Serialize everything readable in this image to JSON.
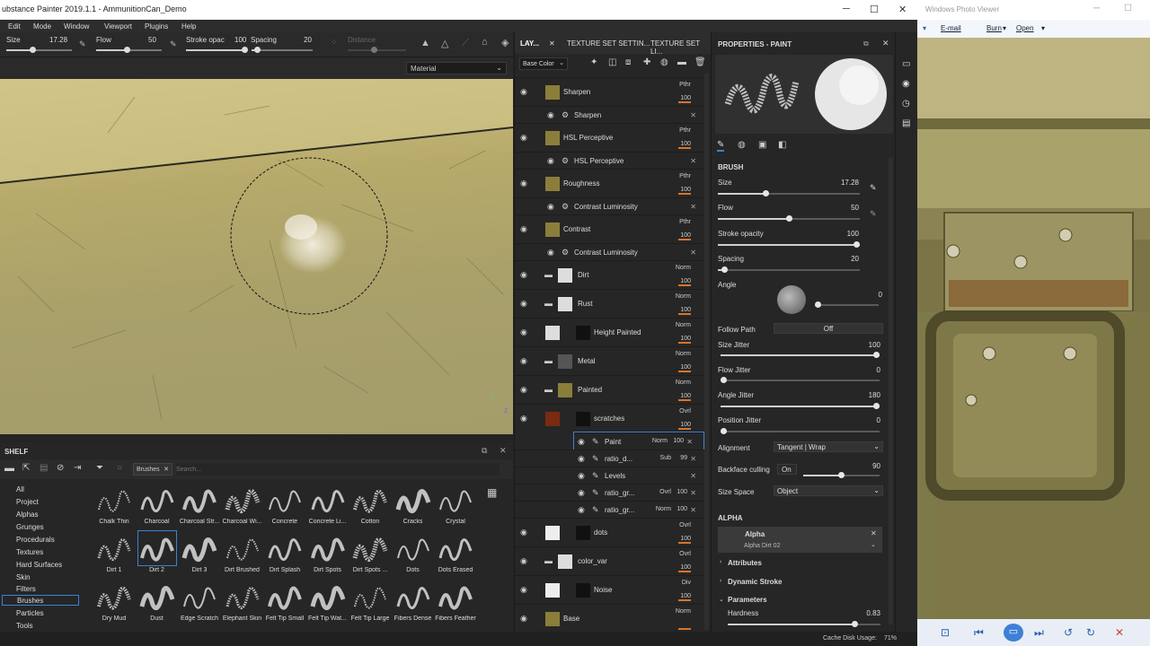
{
  "window": {
    "title": "ubstance Painter 2019.1.1 - AmmunitionCan_Demo"
  },
  "menu": [
    "Edit",
    "Mode",
    "Window",
    "Viewport",
    "Plugins",
    "Help"
  ],
  "toolbar": {
    "size_label": "Size",
    "size_value": "17.28",
    "flow_label": "Flow",
    "flow_value": "50",
    "stroke_label": "Stroke opac",
    "stroke_value": "100",
    "spacing_label": "Spacing",
    "spacing_value": "20",
    "distance_label": "Distance"
  },
  "viewport": {
    "material_select": "Material",
    "axis_x": "Z",
    "axis_y": "Y"
  },
  "shelf": {
    "title": "SHELF",
    "filter_chip": "Brushes",
    "search_placeholder": "Search...",
    "categories": [
      "All",
      "Project",
      "Alphas",
      "Grunges",
      "Procedurals",
      "Textures",
      "Hard Surfaces",
      "Skin",
      "Filters",
      "Brushes",
      "Particles",
      "Tools"
    ],
    "selected_category": "Brushes",
    "row1": [
      "Chalk Thin",
      "Charcoal",
      "Charcoal Str...",
      "Charcoal Wi...",
      "Concrete",
      "Concrete Li...",
      "Cotton",
      "Cracks",
      "Crystal"
    ],
    "row2": [
      "Dirt 1",
      "Dirt 2",
      "Dirt 3",
      "Dirt Brushed",
      "Dirt Splash",
      "Dirt Spots",
      "Dirt Spots ...",
      "Dots",
      "Dots Erased"
    ],
    "row3": [
      "Dry Mud",
      "Dust",
      "Edge Scratch",
      "Elephant Skin",
      "Felt Tip Small",
      "Felt Tip Wat...",
      "Felt Tip Large",
      "Fibers Dense",
      "Fibers Feather"
    ],
    "selected_brush": "Dirt 2"
  },
  "layers": {
    "tabs": [
      "LAY...",
      "TEXTURE SET SETTIN...",
      "TEXTURE SET LI..."
    ],
    "channel_select": "Base Color",
    "rows": [
      {
        "name": "Sharpen",
        "blend": "Pthr",
        "opacity": "100",
        "kind": "layer"
      },
      {
        "name": "Sharpen",
        "kind": "effect"
      },
      {
        "name": "HSL Perceptive",
        "blend": "Pthr",
        "opacity": "100",
        "kind": "layer"
      },
      {
        "name": "HSL Perceptive",
        "kind": "effect"
      },
      {
        "name": "Roughness",
        "blend": "Pthr",
        "opacity": "100",
        "kind": "layer"
      },
      {
        "name": "Contrast Luminosity",
        "kind": "effect"
      },
      {
        "name": "Contrast",
        "blend": "Pthr",
        "opacity": "100",
        "kind": "layer"
      },
      {
        "name": "Contrast Luminosity",
        "kind": "effect"
      },
      {
        "name": "Dirt",
        "blend": "Norm",
        "opacity": "100",
        "kind": "folder"
      },
      {
        "name": "Rust",
        "blend": "Norm",
        "opacity": "100",
        "kind": "folder"
      },
      {
        "name": "Height Painted",
        "blend": "Norm",
        "opacity": "100",
        "kind": "layer"
      },
      {
        "name": "Metal",
        "blend": "Norm",
        "opacity": "100",
        "kind": "folder"
      },
      {
        "name": "Painted",
        "blend": "Norm",
        "opacity": "100",
        "kind": "folder"
      },
      {
        "name": "scratches",
        "blend": "Ovrl",
        "opacity": "100",
        "kind": "layer"
      },
      {
        "name": "Paint",
        "blend": "Norm",
        "opacity": "100",
        "kind": "sub"
      },
      {
        "name": "ratio_d...",
        "blend": "Sub",
        "opacity": "99",
        "kind": "sub"
      },
      {
        "name": "Levels",
        "kind": "sub"
      },
      {
        "name": "ratio_gr...",
        "blend": "Ovrl",
        "opacity": "100",
        "kind": "sub"
      },
      {
        "name": "ratio_gr...",
        "blend": "Norm",
        "opacity": "100",
        "kind": "sub"
      },
      {
        "name": "dots",
        "blend": "Ovrl",
        "opacity": "100",
        "kind": "layer"
      },
      {
        "name": "color_var",
        "blend": "Ovrl",
        "opacity": "100",
        "kind": "folder"
      },
      {
        "name": "Noise",
        "blend": "Div",
        "opacity": "100",
        "kind": "layer"
      },
      {
        "name": "Base",
        "blend": "Norm",
        "opacity": "",
        "kind": "layer"
      }
    ]
  },
  "properties": {
    "title": "PROPERTIES - PAINT",
    "brush_section": "BRUSH",
    "size_label": "Size",
    "size_value": "17.28",
    "size_frac": 0.34,
    "flow_label": "Flow",
    "flow_value": "50",
    "flow_frac": 0.5,
    "stroke_label": "Stroke opacity",
    "stroke_value": "100",
    "stroke_frac": 1.0,
    "spacing_label": "Spacing",
    "spacing_value": "20",
    "spacing_frac": 0.05,
    "angle_label": "Angle",
    "angle_value": "0",
    "follow_path_label": "Follow Path",
    "follow_path_value": "Off",
    "size_jitter_label": "Size Jitter",
    "size_jitter_value": "100",
    "size_jitter_frac": 1.0,
    "flow_jitter_label": "Flow Jitter",
    "flow_jitter_value": "0",
    "flow_jitter_frac": 0.0,
    "angle_jitter_label": "Angle Jitter",
    "angle_jitter_value": "180",
    "angle_jitter_frac": 1.0,
    "position_jitter_label": "Position Jitter",
    "position_jitter_value": "0",
    "position_jitter_frac": 0.0,
    "alignment_label": "Alignment",
    "alignment_value": "Tangent | Wrap",
    "backface_label": "Backface culling",
    "backface_toggle": "On",
    "backface_value": "90",
    "backface_frac": 0.5,
    "size_space_label": "Size Space",
    "size_space_value": "Object",
    "alpha_section": "ALPHA",
    "alpha_label": "Alpha",
    "alpha_name": "Alpha Dirt 02",
    "attributes": "Attributes",
    "dynamic_stroke": "Dynamic Stroke",
    "parameters": "Parameters",
    "hardness_label": "Hardness",
    "hardness_value": "0.83",
    "hardness_frac": 0.83
  },
  "status": {
    "cache": "Cache Disk Usage:",
    "cache_value": "71%"
  },
  "photo_viewer": {
    "title": "Windows Photo Viewer",
    "menu": [
      "E-mail",
      "Burn",
      "Open"
    ]
  }
}
